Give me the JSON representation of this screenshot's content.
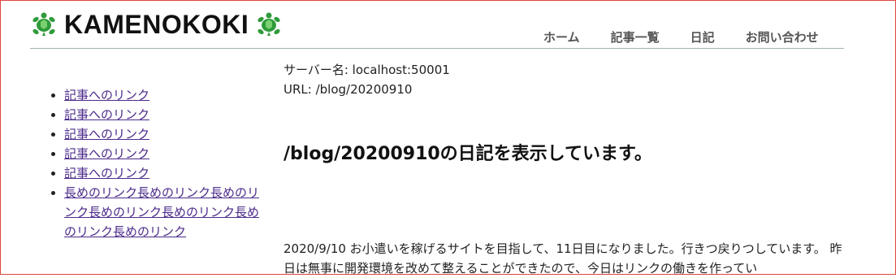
{
  "header": {
    "logo_text": "KAMENOKOKI",
    "logo_icon": "turtle-icon",
    "nav": [
      {
        "label": "ホーム"
      },
      {
        "label": "記事一覧"
      },
      {
        "label": "日記"
      },
      {
        "label": "お問い合わせ"
      }
    ]
  },
  "sidebar": {
    "links": [
      {
        "label": "記事へのリンク"
      },
      {
        "label": "記事へのリンク"
      },
      {
        "label": "記事へのリンク"
      },
      {
        "label": "記事へのリンク"
      },
      {
        "label": "記事へのリンク"
      },
      {
        "label": "長めのリンク長めのリンク長めのリンク長めのリンク長めのリンク長めのリンク長めのリンク"
      }
    ]
  },
  "main": {
    "server_line": "サーバー名: localhost:50001",
    "url_line": "URL: /blog/20200910",
    "heading": "/blog/20200910の日記を表示しています。",
    "body_text": "2020/9/10 お小遣いを稼げるサイトを目指して、11日目になりました。行きつ戻りつしています。 昨日は無事に開発環境を改めて整えることができたので、今日はリンクの働きを作ってい"
  },
  "colors": {
    "turtle_green": "#2e9b3a",
    "turtle_light": "#7bd06f",
    "link": "#4b2a8a",
    "nav_text": "#555555",
    "header_rule": "#9fb4b4",
    "frame_border": "#e0453f"
  }
}
